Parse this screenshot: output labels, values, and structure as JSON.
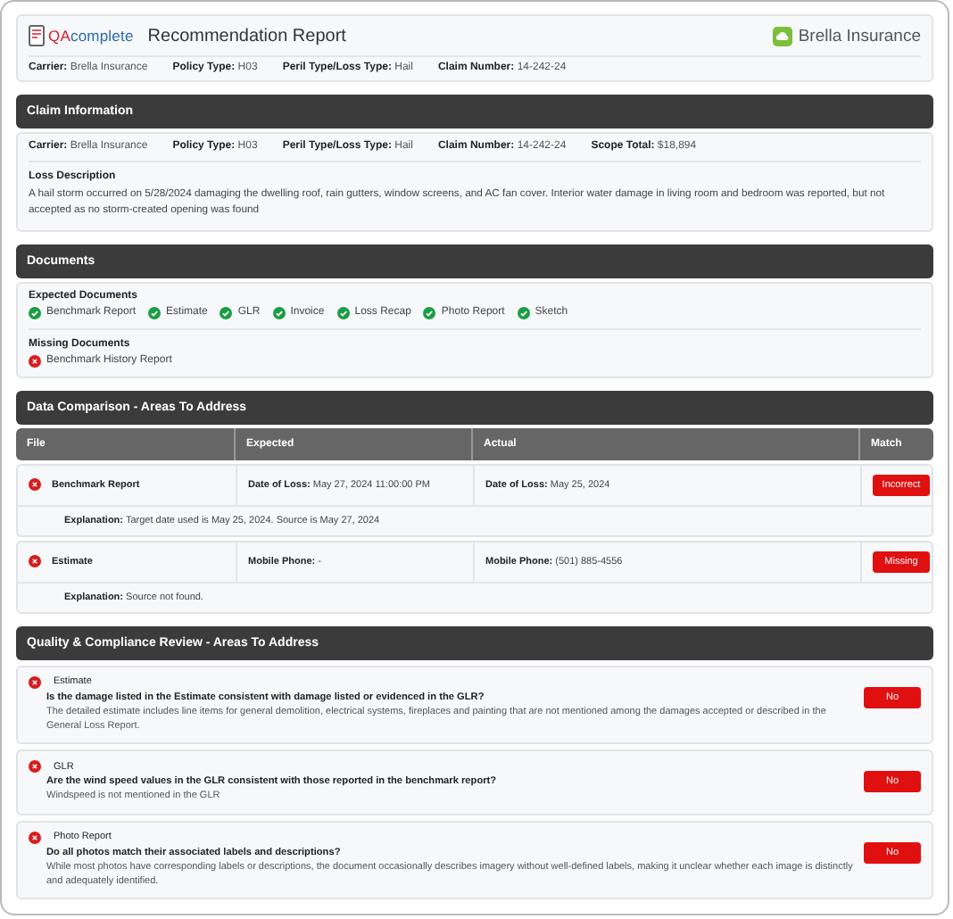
{
  "header": {
    "logo": {
      "prefix": "QA",
      "suffix": "complete"
    },
    "title": "Recommendation Report",
    "brand": "Brella Insurance",
    "meta": [
      "**Carrier:** Brella Insurance",
      "**Policy Type:** H03",
      "**Peril Type/Loss Type:** Hail",
      "**Claim Number:** 14-242-24"
    ]
  },
  "claim_information": {
    "title": "Claim Information",
    "fields": [
      "**Carrier:** Brella Insurance",
      "**Policy Type:** H03",
      "**Peril Type/Loss Type:** Hail",
      "**Claim Number:** 14-242-24",
      "**Scope Total:** $18,894"
    ],
    "loss_description": {
      "label": "Loss Description",
      "text": "A hail storm occurred on 5/28/2024 damaging the dwelling roof, rain gutters, window screens, and AC fan cover. Interior water damage in living room and bedroom was reported, but not accepted as no storm-created opening was found"
    }
  },
  "documents": {
    "title": "Documents",
    "groups": [
      {
        "label": "Expected Documents",
        "items": [
          {
            "name": "Benchmark Report",
            "kind": "check"
          },
          {
            "name": "Estimate",
            "kind": "check"
          },
          {
            "name": "GLR",
            "kind": "check"
          },
          {
            "name": "Invoice",
            "kind": "check"
          },
          {
            "name": "Loss Recap",
            "kind": "check"
          },
          {
            "name": "Photo Report",
            "kind": "check"
          },
          {
            "name": "Sketch",
            "kind": "check"
          }
        ]
      },
      {
        "label": "Missing Documents",
        "items": [
          {
            "name": "Benchmark History Report",
            "kind": "cross"
          }
        ]
      }
    ]
  },
  "data_comparison": {
    "title": "Data Comparison - Areas To Address",
    "columns": [
      "File",
      "Expected",
      "Actual",
      "Match"
    ],
    "rows": [
      {
        "file": "Benchmark Report",
        "kind": "cross",
        "expected": "**Date of Loss:** May 27, 2024 11:00:00 PM",
        "actual": "**Date of Loss:** May 25, 2024",
        "match": "Incorrect",
        "explanation": "**Explanation:** Target date used is May 25, 2024. Source is May 27, 2024"
      },
      {
        "file": "Estimate",
        "kind": "cross",
        "expected": "**Mobile Phone:** -",
        "actual": "**Mobile Phone:** (501) 885-4556",
        "match": "Missing",
        "explanation": "**Explanation:** Source not found."
      }
    ]
  },
  "quality_review": {
    "title": "Quality & Compliance Review - Areas To Address",
    "items": [
      {
        "file": "Estimate",
        "kind": "cross",
        "question": "Is the damage listed in the Estimate consistent with damage listed or evidenced in the GLR?",
        "detail": "The detailed estimate includes line items for general demolition, electrical systems, fireplaces and painting that are not mentioned among the damages accepted or described in the General Loss Report.",
        "answer": "No"
      },
      {
        "file": "GLR",
        "kind": "cross",
        "question": "Are the wind speed values in the GLR consistent with those reported in the benchmark report?",
        "detail": "Windspeed is not mentioned in the GLR",
        "answer": "No"
      },
      {
        "file": "Photo Report",
        "kind": "cross",
        "question": "Do all photos match their associated labels and descriptions?",
        "detail": "While most photos have corresponding labels or descriptions, the document occasionally describes imagery without well-defined labels, making it unclear whether each image is distinctly and adequately identified.",
        "answer": "No"
      }
    ]
  }
}
